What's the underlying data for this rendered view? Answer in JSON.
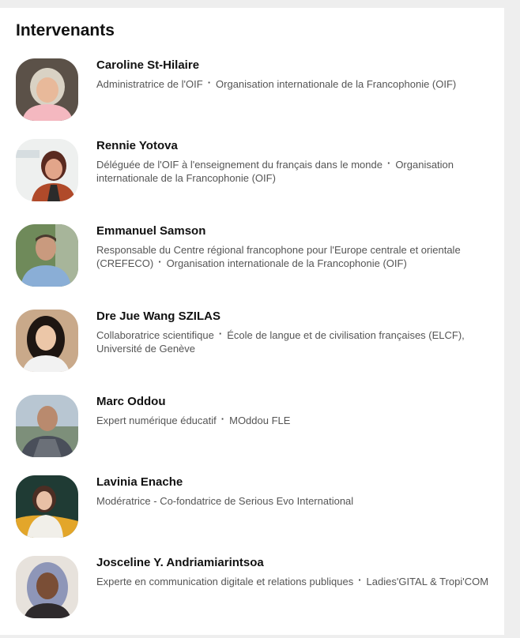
{
  "section": {
    "title": "Intervenants"
  },
  "speakers": [
    {
      "name": "Caroline St-Hilaire",
      "role": "Administratrice de l'OIF",
      "org": "Organisation internationale de la Francophonie (OIF)"
    },
    {
      "name": "Rennie Yotova",
      "role": "Déléguée de l'OIF à l'enseignement du français dans le monde",
      "org": "Organisation internationale de la Francophonie (OIF)"
    },
    {
      "name": "Emmanuel Samson",
      "role": "Responsable du Centre régional francophone pour l'Europe centrale et orientale (CREFECO)",
      "org": "Organisation internationale de la Francophonie (OIF)"
    },
    {
      "name": "Dre Jue Wang SZILAS",
      "role": "Collaboratrice scientifique",
      "org": "École de langue et de civilisation françaises (ELCF), Université de Genève"
    },
    {
      "name": "Marc Oddou",
      "role": "Expert numérique éducatif",
      "org": "MOddou FLE"
    },
    {
      "name": "Lavinia Enache",
      "role": "Modératrice - Co-fondatrice de Serious Evo International",
      "org": ""
    },
    {
      "name": "Josceline Y. Andriamiarintsoa",
      "role": "Experte en communication digitale et relations publiques",
      "org": "Ladies'GITAL & Tropi'COM"
    }
  ]
}
